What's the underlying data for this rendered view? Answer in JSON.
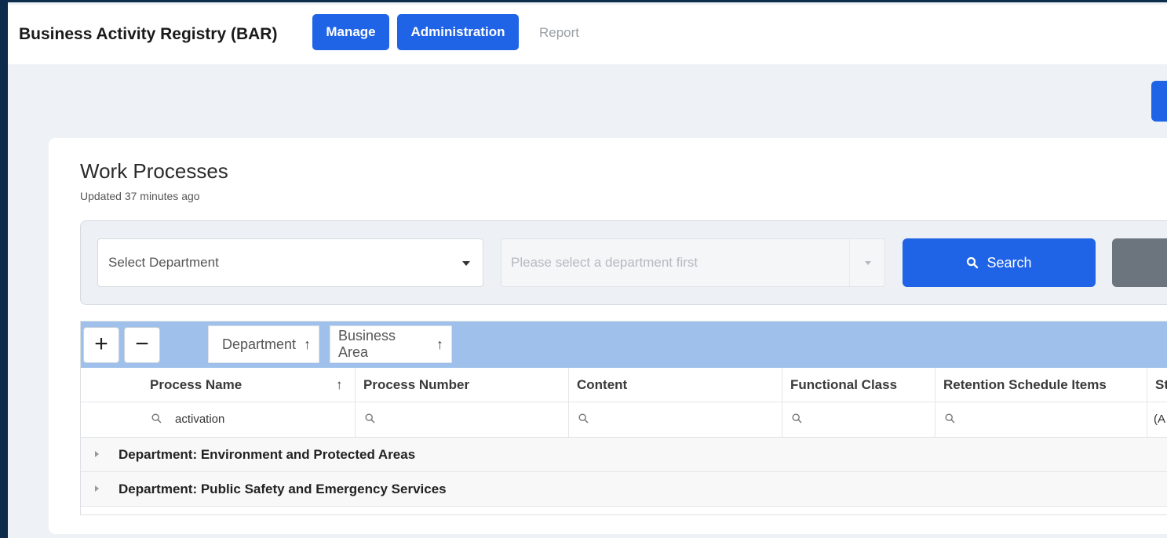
{
  "app": {
    "title": "Business Activity Registry (BAR)",
    "nav": [
      {
        "label": "Manage"
      },
      {
        "label": "Administration"
      },
      {
        "label": "Report"
      }
    ]
  },
  "page": {
    "title": "Work Processes",
    "updated": "Updated 37 minutes ago"
  },
  "filters": {
    "department_placeholder": "Select Department",
    "business_area_placeholder": "Please select a department first",
    "search_label": "Search"
  },
  "grid": {
    "group_chips": [
      {
        "label": "Department"
      },
      {
        "label": "Business Area"
      }
    ],
    "sort_arrow": "↑",
    "columns": [
      {
        "label": "Process Name",
        "filter": "activation"
      },
      {
        "label": "Process Number",
        "filter": ""
      },
      {
        "label": "Content",
        "filter": ""
      },
      {
        "label": "Functional Class",
        "filter": ""
      },
      {
        "label": "Retention Schedule Items",
        "filter": ""
      },
      {
        "label": "St",
        "filter": "(A"
      }
    ],
    "groups": [
      {
        "label": "Department: Environment and Protected Areas"
      },
      {
        "label": "Department: Public Safety and Emergency Services"
      }
    ]
  },
  "colors": {
    "primary": "#1f63e6",
    "group_panel": "#9ec0ea",
    "secondary": "#6c757d"
  }
}
